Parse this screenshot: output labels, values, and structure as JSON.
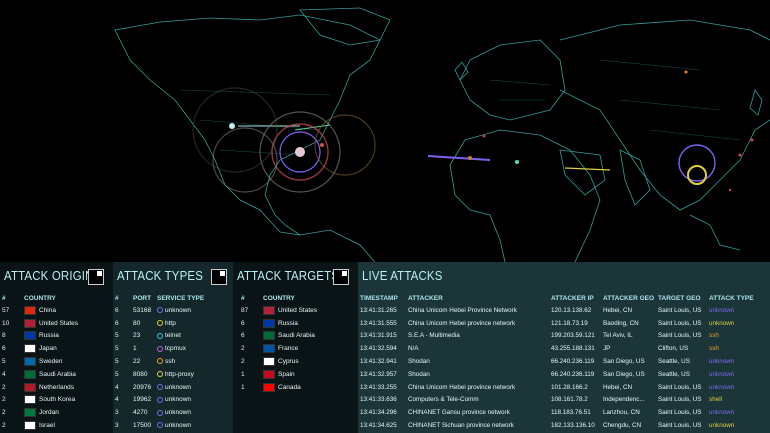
{
  "colors": {
    "panel_dark": "#0a1416",
    "panel_mid": "#14282c",
    "panel_live": "#1c3538",
    "title": "#b8f0f4",
    "map_lines": "#3fb8b0",
    "unknown": "#7b6cf0",
    "ssh": "#f0a030",
    "http": "#e0d040",
    "shell": "#e0d040"
  },
  "origins": {
    "title": "ATTACK ORIGINS",
    "headers": [
      "#",
      "COUNTRY"
    ],
    "rows": [
      {
        "count": "57",
        "country": "China",
        "flag": "#de2910"
      },
      {
        "count": "10",
        "country": "United States",
        "flag": "#b22234"
      },
      {
        "count": "8",
        "country": "Russia",
        "flag": "#0039a6"
      },
      {
        "count": "6",
        "country": "Japan",
        "flag": "#ffffff"
      },
      {
        "count": "5",
        "country": "Sweden",
        "flag": "#006aa7"
      },
      {
        "count": "4",
        "country": "Saudi Arabia",
        "flag": "#006c35"
      },
      {
        "count": "2",
        "country": "Netherlands",
        "flag": "#ae1c28"
      },
      {
        "count": "2",
        "country": "South Korea",
        "flag": "#ffffff"
      },
      {
        "count": "2",
        "country": "Jordan",
        "flag": "#007a3d"
      },
      {
        "count": "2",
        "country": "Israel",
        "flag": "#ffffff"
      }
    ]
  },
  "types": {
    "title": "ATTACK TYPES",
    "headers": [
      "#",
      "PORT",
      "SERVICE TYPE"
    ],
    "rows": [
      {
        "count": "6",
        "port": "53168",
        "service": "unknown",
        "color": "#7b6cf0"
      },
      {
        "count": "6",
        "port": "80",
        "service": "http",
        "color": "#e0d040"
      },
      {
        "count": "5",
        "port": "23",
        "service": "telnet",
        "color": "#40c0e0"
      },
      {
        "count": "5",
        "port": "1",
        "service": "tcpmux",
        "color": "#c060e0"
      },
      {
        "count": "5",
        "port": "22",
        "service": "ssh",
        "color": "#f0a030"
      },
      {
        "count": "5",
        "port": "8080",
        "service": "http-proxy",
        "color": "#e0d040"
      },
      {
        "count": "4",
        "port": "20976",
        "service": "unknown",
        "color": "#7b6cf0"
      },
      {
        "count": "4",
        "port": "19962",
        "service": "unknown",
        "color": "#7b6cf0"
      },
      {
        "count": "3",
        "port": "4270",
        "service": "unknown",
        "color": "#7b6cf0"
      },
      {
        "count": "3",
        "port": "17500",
        "service": "unknown",
        "color": "#7b6cf0"
      }
    ]
  },
  "targets": {
    "title": "ATTACK TARGETS",
    "headers": [
      "#",
      "COUNTRY"
    ],
    "rows": [
      {
        "count": "87",
        "country": "United States",
        "flag": "#b22234"
      },
      {
        "count": "6",
        "country": "Russia",
        "flag": "#0039a6"
      },
      {
        "count": "6",
        "country": "Saudi Arabia",
        "flag": "#006c35"
      },
      {
        "count": "2",
        "country": "France",
        "flag": "#0055a4"
      },
      {
        "count": "2",
        "country": "Cyprus",
        "flag": "#ffffff"
      },
      {
        "count": "1",
        "country": "Spain",
        "flag": "#c60b1e"
      },
      {
        "count": "1",
        "country": "Canada",
        "flag": "#ff0000"
      }
    ]
  },
  "live": {
    "title": "LIVE ATTACKS",
    "headers": [
      "TIMESTAMP",
      "ATTACKER",
      "ATTACKER IP",
      "ATTACKER GEO",
      "TARGET GEO",
      "ATTACK TYPE"
    ],
    "rows": [
      {
        "ts": "13:41:31.265",
        "attacker": "China Unicom Hebei Province Network",
        "ip": "120.13.138.62",
        "geo": "Hebei, CN",
        "target": "Saint Louis, US",
        "type": "unknown",
        "color": "#7b6cf0"
      },
      {
        "ts": "13:41:31.555",
        "attacker": "China Unicom Hebei province network",
        "ip": "121.18.73.19",
        "geo": "Baoding, CN",
        "target": "Saint Louis, US",
        "type": "unknown",
        "color": "#e0d040"
      },
      {
        "ts": "13:41:31.915",
        "attacker": "S.E.A - Multimedia",
        "ip": "199.203.59.121",
        "geo": "Tel Aviv, IL",
        "target": "Saint Louis, US",
        "type": "ssh",
        "color": "#f0a030"
      },
      {
        "ts": "13:41:32.594",
        "attacker": "N/A",
        "ip": "43.255.188.131",
        "geo": "JP",
        "target": "Clifton, US",
        "type": "ssh",
        "color": "#f0a030"
      },
      {
        "ts": "13:41:32.941",
        "attacker": "Shodan",
        "ip": "66.240.236.119",
        "geo": "San Diego, US",
        "target": "Seattle, US",
        "type": "unknown",
        "color": "#7b6cf0"
      },
      {
        "ts": "13:41:32.957",
        "attacker": "Shodan",
        "ip": "66.240.236.119",
        "geo": "San Diego, US",
        "target": "Seattle, US",
        "type": "unknown",
        "color": "#7b6cf0"
      },
      {
        "ts": "13:41:33.255",
        "attacker": "China Unicom Hebei province network",
        "ip": "101.28.166.2",
        "geo": "Hebei, CN",
        "target": "Saint Louis, US",
        "type": "unknown",
        "color": "#7b6cf0"
      },
      {
        "ts": "13:41:33.636",
        "attacker": "Computers & Tele-Comm",
        "ip": "108.161.78.2",
        "geo": "Independenc...",
        "target": "Saint Louis, US",
        "type": "shell",
        "color": "#e0d040"
      },
      {
        "ts": "13:41:34.296",
        "attacker": "CHINANET Gansu province network",
        "ip": "118.183.76.51",
        "geo": "Lanzhou, CN",
        "target": "Saint Louis, US",
        "type": "unknown",
        "color": "#7b6cf0"
      },
      {
        "ts": "13:41:34.625",
        "attacker": "CHINANET Sichuan province network",
        "ip": "182.133.136.10",
        "geo": "Chengdu, CN",
        "target": "Saint Louis, US",
        "type": "unknown",
        "color": "#e0d040"
      }
    ]
  }
}
